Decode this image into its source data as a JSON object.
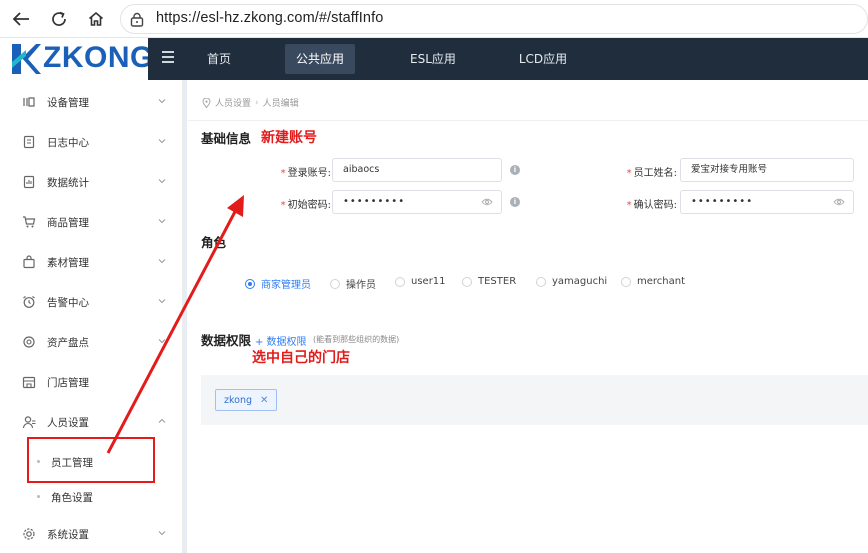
{
  "browser": {
    "url": "https://esl-hz.zkong.com/#/staffInfo",
    "back_icon": "back-arrow-icon",
    "reload_icon": "reload-icon",
    "home_icon": "home-icon",
    "lock_icon": "site-info-icon"
  },
  "logo": {
    "text": "ZKONG",
    "accent": "#1b60b8"
  },
  "header": {
    "tabs": [
      {
        "label": "首页",
        "active": false
      },
      {
        "label": "公共应用",
        "active": true
      },
      {
        "label": "ESL应用",
        "active": false
      },
      {
        "label": "LCD应用",
        "active": false
      }
    ],
    "background": "#1f2d3d"
  },
  "sidebar": {
    "items": [
      {
        "label": "设备管理",
        "icon": "device-icon"
      },
      {
        "label": "日志中心",
        "icon": "log-icon"
      },
      {
        "label": "数据统计",
        "icon": "stats-icon"
      },
      {
        "label": "商品管理",
        "icon": "cart-icon"
      },
      {
        "label": "素材管理",
        "icon": "bag-icon"
      },
      {
        "label": "告警中心",
        "icon": "alarm-icon"
      },
      {
        "label": "资产盘点",
        "icon": "asset-icon"
      },
      {
        "label": "门店管理",
        "icon": "store-icon"
      },
      {
        "label": "人员设置",
        "icon": "person-icon",
        "expanded": true
      },
      {
        "label": "系统设置",
        "icon": "settings-icon"
      }
    ],
    "sub_items": [
      {
        "label": "员工管理",
        "active": true
      },
      {
        "label": "角色设置",
        "active": false
      }
    ]
  },
  "breadcrumb": {
    "items": [
      "人员设置",
      "人员编辑"
    ]
  },
  "basic_info": {
    "title": "基础信息",
    "annotation": "新建账号",
    "fields": {
      "login_account": {
        "label": "登录账号:",
        "value": "aibaocs"
      },
      "staff_name": {
        "label": "员工姓名:",
        "value": "爱宝对接专用账号"
      },
      "initial_password": {
        "label": "初始密码:",
        "value": "•••••••••"
      },
      "confirm_password": {
        "label": "确认密码:",
        "value": "•••••••••"
      }
    }
  },
  "role": {
    "title": "角色",
    "options": [
      {
        "label": "商家管理员",
        "checked": true
      },
      {
        "label": "操作员",
        "checked": false
      },
      {
        "label": "user11",
        "checked": false
      },
      {
        "label": "TESTER",
        "checked": false
      },
      {
        "label": "yamaguchi",
        "checked": false
      },
      {
        "label": "merchant",
        "checked": false
      }
    ]
  },
  "permission": {
    "title": "数据权限",
    "link": "+ 数据权限",
    "hint": "(能看到那些组织的数据)",
    "annotation": "选中自己的门店",
    "tags": [
      "zkong"
    ]
  },
  "colors": {
    "primary": "#2f7cf6",
    "annotation_red": "#e31b1b"
  }
}
